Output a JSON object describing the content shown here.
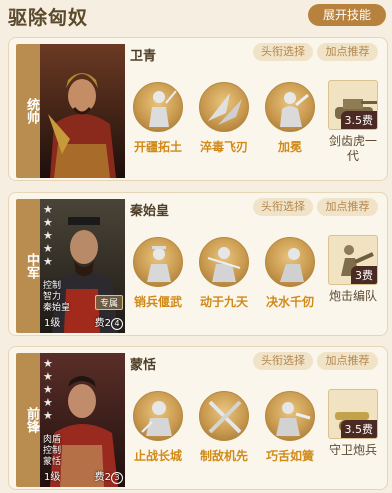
{
  "header": {
    "title": "驱除匈奴",
    "expand_label": "展开技能"
  },
  "cards": [
    {
      "position": "统帅",
      "hero_name": "卫青",
      "head_btn": "头衔选择",
      "point_btn": "加点推荐",
      "skills": [
        {
          "label": "开疆拓土",
          "icon": "general-figure-icon"
        },
        {
          "label": "淬毒飞刃",
          "icon": "flying-blades-icon"
        },
        {
          "label": "加冕",
          "icon": "crowning-figure-icon"
        }
      ],
      "tactic": {
        "label": "剑齿虎一代",
        "cost": "3.5费",
        "icon": "tank-icon"
      }
    },
    {
      "position": "中军",
      "hero_name": "秦始皇",
      "head_btn": "头衔选择",
      "point_btn": "加点推荐",
      "stars": 5,
      "tags": [
        "控制",
        "智力",
        "秦始皇"
      ],
      "level": "1级",
      "cost_text": "费2",
      "stack": "4",
      "special_tag": "专属",
      "skills": [
        {
          "label": "销兵偃武",
          "icon": "emperor-figure-icon"
        },
        {
          "label": "动于九天",
          "icon": "soldier-figure-icon"
        },
        {
          "label": "决水千仞",
          "icon": "kneeling-figure-icon"
        }
      ],
      "tactic": {
        "label": "炮击编队",
        "cost": "3费",
        "icon": "artillery-squad-icon"
      }
    },
    {
      "position": "前锋",
      "hero_name": "蒙恬",
      "head_btn": "头衔选择",
      "point_btn": "加点推荐",
      "stars": 5,
      "tags": [
        "肉盾",
        "控制",
        "蒙恬"
      ],
      "level": "1级",
      "cost_text": "费2",
      "stack": "3",
      "skills": [
        {
          "label": "止战长城",
          "icon": "helmet-warrior-icon"
        },
        {
          "label": "制敌机先",
          "icon": "crossed-swords-icon"
        },
        {
          "label": "巧舌如簧",
          "icon": "speaking-figure-icon"
        }
      ],
      "tactic": {
        "label": "守卫炮兵",
        "cost": "3.5费",
        "icon": "cannon-icon"
      }
    }
  ]
}
